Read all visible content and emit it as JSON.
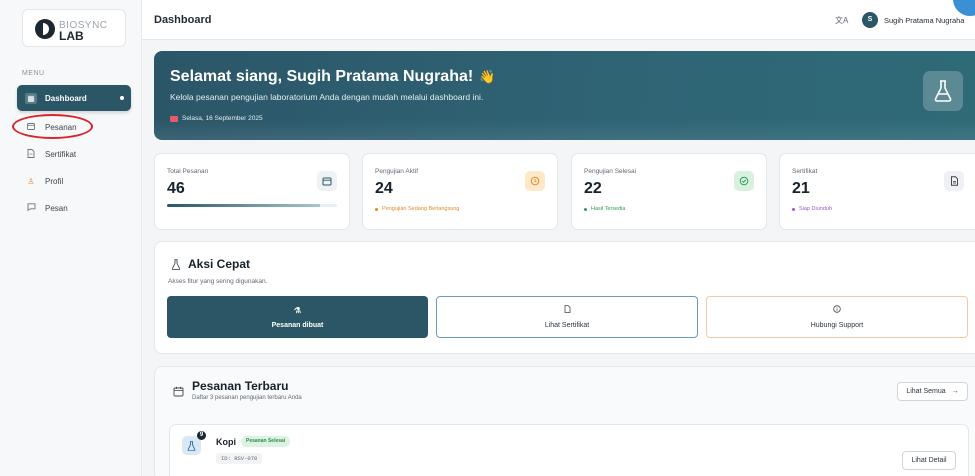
{
  "brand": {
    "line1": "BIOSYNC",
    "line2": "LAB"
  },
  "sidebar": {
    "menu_label": "MENU",
    "items": [
      {
        "label": "Dashboard",
        "icon": "grid-icon",
        "active": true
      },
      {
        "label": "Pesanan",
        "icon": "calendar-icon",
        "active": false
      },
      {
        "label": "Sertifikat",
        "icon": "document-icon",
        "active": false
      },
      {
        "label": "Profil",
        "icon": "user-icon",
        "active": false
      },
      {
        "label": "Pesan",
        "icon": "message-icon",
        "active": false
      }
    ]
  },
  "header": {
    "title": "Dashboard",
    "avatar_initial": "S",
    "user_name": "Sugih Pratama Nugraha"
  },
  "hero": {
    "greeting": "Selamat siang, Sugih Pratama Nugraha!",
    "wave": "👋",
    "subtitle": "Kelola pesanan pengujian laboratorium Anda dengan mudah melalui dashboard ini.",
    "date": "Selasa, 16 September 2025"
  },
  "stats": [
    {
      "label": "Total Pesanan",
      "value": "46",
      "icon": "calendar-icon",
      "progress": 0.9
    },
    {
      "label": "Pengujian Aktif",
      "value": "24",
      "icon": "clock-icon",
      "note": "Pengujian Sedang Berlangsung",
      "color": "#e8892b"
    },
    {
      "label": "Pengujian Selesai",
      "value": "22",
      "icon": "check-circle-icon",
      "note": "Hasil Tersedia",
      "color": "#2e9e57"
    },
    {
      "label": "Sertifikat",
      "value": "21",
      "icon": "document-icon",
      "note": "Siap Diunduh",
      "color": "#9b59d0"
    }
  ],
  "quick_actions": {
    "title": "Aksi Cepat",
    "subtitle": "Akses fitur yang sering digunakan.",
    "buttons": [
      {
        "label": "Pesanan dibuat",
        "icon": "flask-icon"
      },
      {
        "label": "Lihat Sertifikat",
        "icon": "document-icon"
      },
      {
        "label": "Hubungi Support",
        "icon": "info-icon"
      }
    ]
  },
  "recent_orders": {
    "title": "Pesanan Terbaru",
    "subtitle": "Daftar 3 pesanan pengujian terbaru Anda",
    "view_all": "Lihat Semua",
    "orders": [
      {
        "badge": "9",
        "name": "Kopi",
        "status": "Pesanan Selesai",
        "id": "ID: RSV-070",
        "detail": "Lihat Detail"
      }
    ]
  },
  "colors": {
    "primary": "#2a5666",
    "accent_ring": "#d7262c"
  }
}
